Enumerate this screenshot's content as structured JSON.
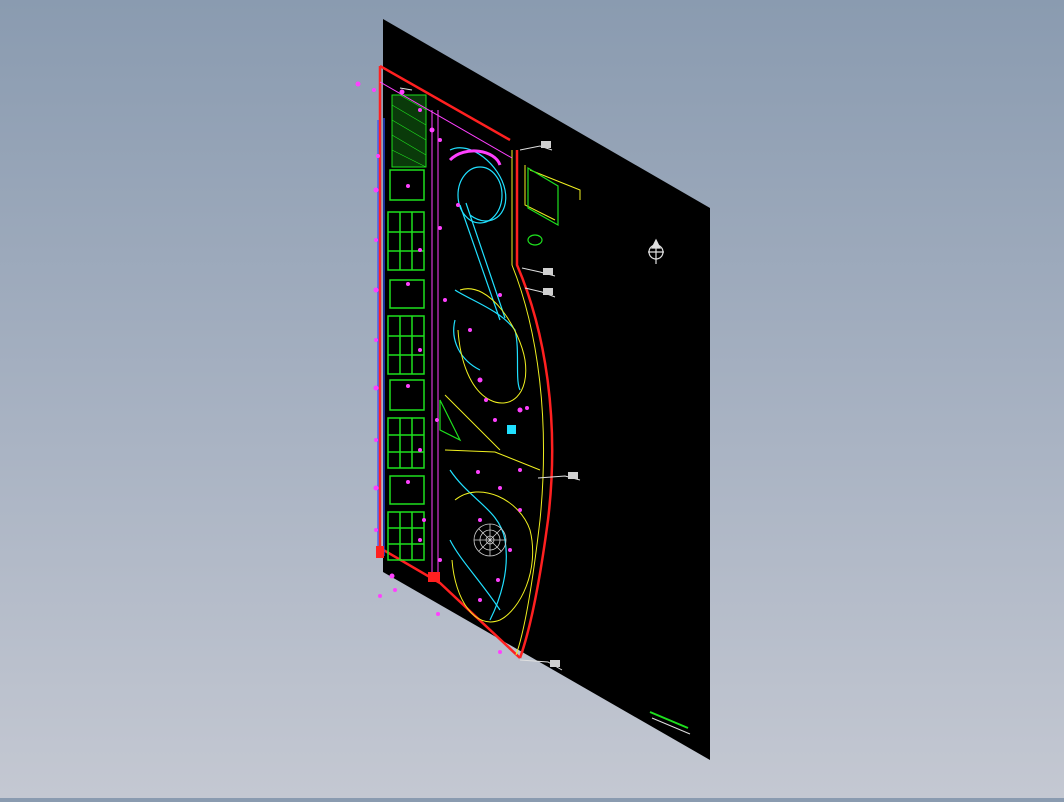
{
  "viewport": {
    "background_top": "#8a9bb0",
    "background_bottom": "#c4c8d2"
  },
  "drawing": {
    "sheet_color": "#000000",
    "colors": {
      "red": "#ff2020",
      "green": "#1ee01e",
      "cyan": "#20e0ff",
      "yellow": "#f0f020",
      "magenta": "#ff40ff",
      "white": "#e0e0e0",
      "blue": "#3050ff"
    },
    "labels": {
      "north_arrow": "north-arrow-icon",
      "title_block": "title-block"
    }
  }
}
